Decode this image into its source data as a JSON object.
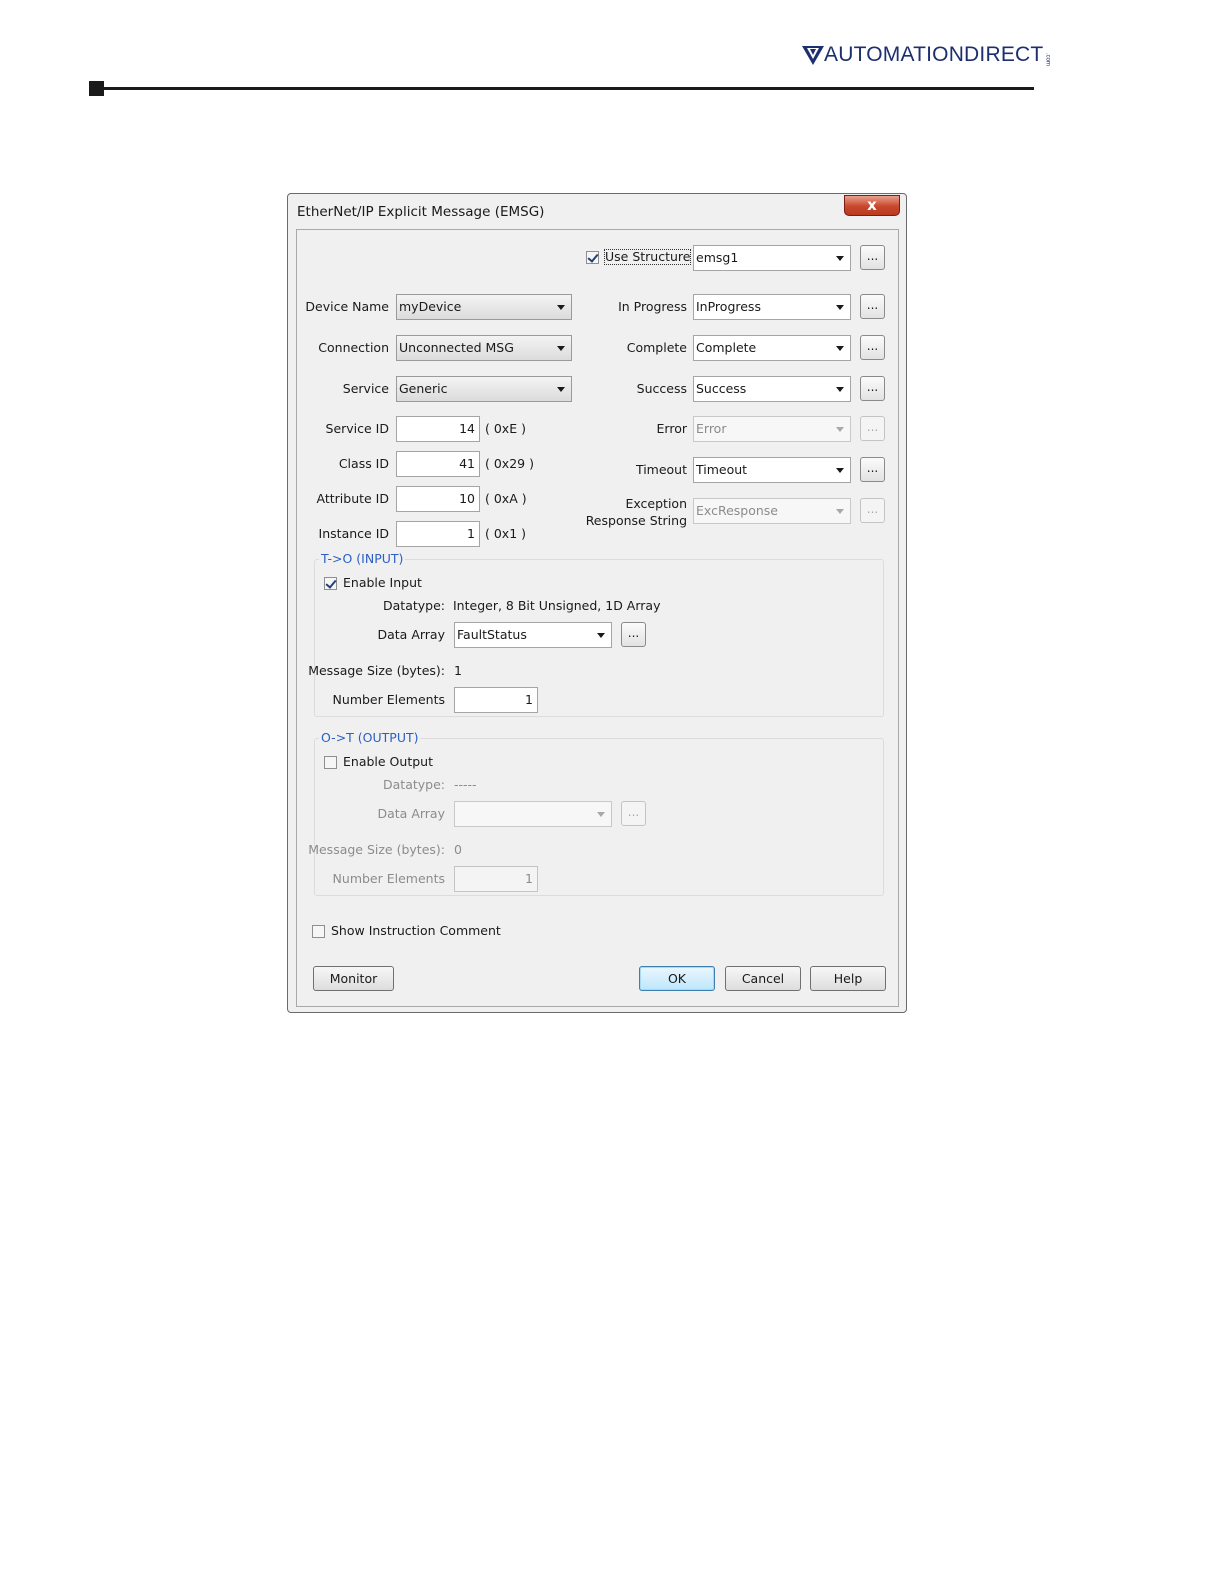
{
  "page": {
    "logo": {
      "text": "AUTOMATIONDIRECT",
      "suffix": ".com"
    }
  },
  "dialog": {
    "title": "EtherNet/IP Explicit Message (EMSG)",
    "close_glyph": "x",
    "use_structure": {
      "label": "Use Structure",
      "checked": true,
      "value": "emsg1"
    },
    "fields_left": {
      "device_name": {
        "label": "Device Name",
        "value": "myDevice"
      },
      "connection": {
        "label": "Connection",
        "value": "Unconnected MSG"
      },
      "service": {
        "label": "Service",
        "value": "Generic"
      },
      "service_id": {
        "label": "Service ID",
        "value": "14",
        "hex": "( 0xE )"
      },
      "class_id": {
        "label": "Class ID",
        "value": "41",
        "hex": "( 0x29 )"
      },
      "attribute_id": {
        "label": "Attribute ID",
        "value": "10",
        "hex": "( 0xA )"
      },
      "instance_id": {
        "label": "Instance ID",
        "value": "1",
        "hex": "( 0x1 )"
      }
    },
    "fields_right": {
      "in_progress": {
        "label": "In Progress",
        "value": "InProgress"
      },
      "complete": {
        "label": "Complete",
        "value": "Complete"
      },
      "success": {
        "label": "Success",
        "value": "Success"
      },
      "error": {
        "label": "Error",
        "value": "Error",
        "enabled": false
      },
      "timeout": {
        "label": "Timeout",
        "value": "Timeout"
      },
      "exception": {
        "label_line1": "Exception",
        "label_line2": "Response String",
        "value": "ExcResponse",
        "enabled": false
      }
    },
    "dots_label": "...",
    "input_group": {
      "title": "T->O (INPUT)",
      "enable_label": "Enable Input",
      "enabled": true,
      "datatype_label": "Datatype:",
      "datatype_value": "Integer, 8 Bit Unsigned, 1D Array",
      "data_array_label": "Data Array",
      "data_array_value": "FaultStatus",
      "message_size_label": "Message Size (bytes):",
      "message_size_value": "1",
      "number_elements_label": "Number Elements",
      "number_elements_value": "1"
    },
    "output_group": {
      "title": "O->T (OUTPUT)",
      "enable_label": "Enable Output",
      "enabled": false,
      "datatype_label": "Datatype:",
      "datatype_value": "-----",
      "data_array_label": "Data Array",
      "data_array_value": "",
      "message_size_label": "Message Size (bytes):",
      "message_size_value": "0",
      "number_elements_label": "Number Elements",
      "number_elements_value": "1"
    },
    "show_comment": {
      "label": "Show Instruction Comment",
      "checked": false
    },
    "buttons": {
      "monitor": "Monitor",
      "ok": "OK",
      "cancel": "Cancel",
      "help": "Help"
    },
    "colors": {
      "group_title": "#2a5fc4",
      "close_button": "#c7482c",
      "default_button": "#bee6fd"
    }
  }
}
